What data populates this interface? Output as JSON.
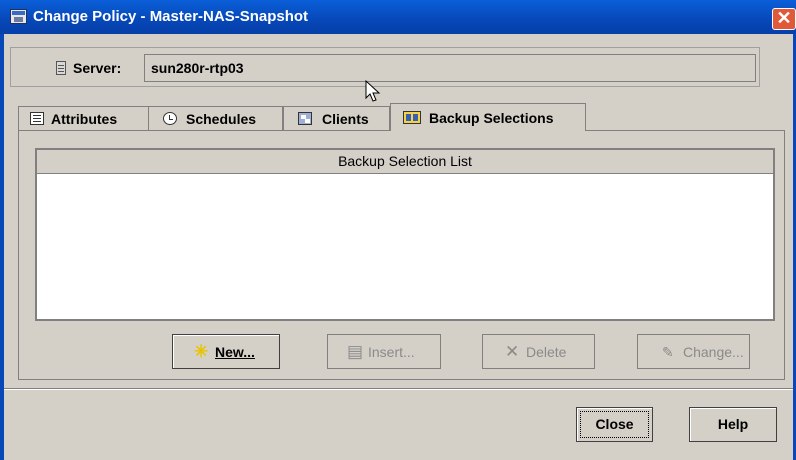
{
  "window": {
    "title": "Change Policy - Master-NAS-Snapshot",
    "close_glyph": "✕"
  },
  "server": {
    "label": "Server:",
    "value": "sun280r-rtp03",
    "icon": "server-icon"
  },
  "tabs": [
    {
      "label": "Attributes",
      "icon": "attributes-icon",
      "active": false
    },
    {
      "label": "Schedules",
      "icon": "schedules-icon",
      "active": false
    },
    {
      "label": "Clients",
      "icon": "clients-icon",
      "active": false
    },
    {
      "label": "Backup Selections",
      "icon": "backup-selections-icon",
      "active": true
    }
  ],
  "backup_list": {
    "header": "Backup Selection List",
    "items": []
  },
  "list_buttons": [
    {
      "label": "New...",
      "icon": "new-star-icon",
      "glyph": "✳",
      "enabled": true
    },
    {
      "label": "Insert...",
      "icon": "insert-icon",
      "glyph": "▤",
      "enabled": false
    },
    {
      "label": "Delete",
      "icon": "delete-icon",
      "glyph": "✕",
      "enabled": false
    },
    {
      "label": "Change...",
      "icon": "change-icon",
      "glyph": "✎",
      "enabled": false
    }
  ],
  "dialog_buttons": {
    "close": "Close",
    "help": "Help"
  },
  "colors": {
    "titlebar": "#0747b8",
    "background": "#d4d0c8",
    "close_button": "#e05a3a",
    "new_icon": "#e8c400"
  }
}
